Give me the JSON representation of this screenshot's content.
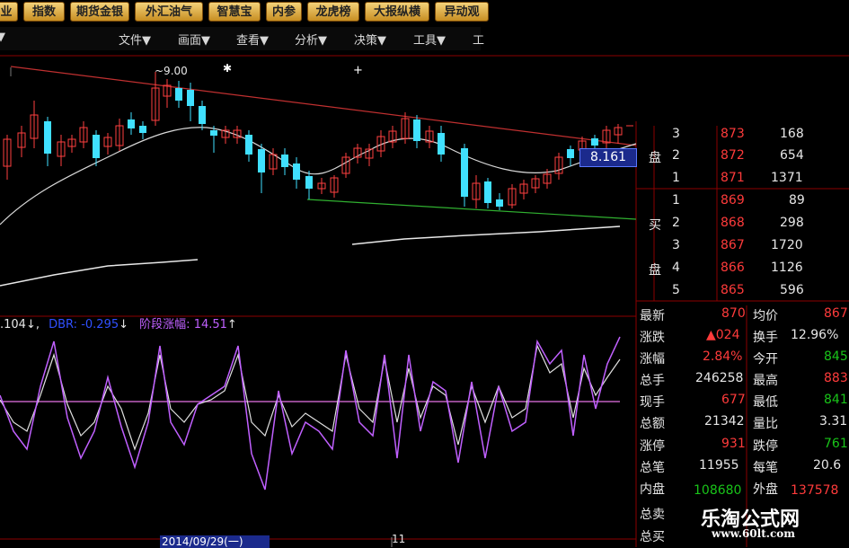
{
  "toolbar": [
    "业",
    "指数",
    "期货金银",
    "外汇油气",
    "智慧宝",
    "内参",
    "龙虎榜",
    "大报纵横",
    "异动观"
  ],
  "menu": [
    "文件▼",
    "画面▼",
    "查看▼",
    "分析▼",
    "决策▼",
    "工具▼",
    "工"
  ],
  "chart": {
    "high_label": "~9.00",
    "price_marker": "8.161",
    "date": "2014/09/29(一)",
    "marker_11": "11"
  },
  "indicator": {
    "v1": ".104",
    "v2": "0.295",
    "label": "阶段涨幅:",
    "value": "14.51"
  },
  "orderbook": {
    "sell_label": [
      "盘"
    ],
    "buy_label": [
      "买",
      "盘"
    ],
    "asks": [
      {
        "lvl": "3",
        "price": "873",
        "vol": "168"
      },
      {
        "lvl": "2",
        "price": "872",
        "vol": "654"
      },
      {
        "lvl": "1",
        "price": "871",
        "vol": "1371"
      }
    ],
    "bids": [
      {
        "lvl": "1",
        "price": "869",
        "vol": "89"
      },
      {
        "lvl": "2",
        "price": "868",
        "vol": "298"
      },
      {
        "lvl": "3",
        "price": "867",
        "vol": "1720"
      },
      {
        "lvl": "4",
        "price": "866",
        "vol": "1126"
      },
      {
        "lvl": "5",
        "price": "865",
        "vol": "596"
      }
    ]
  },
  "stats": [
    {
      "l1": "最新",
      "v1": "870",
      "l2": "均价",
      "v2": "867"
    },
    {
      "l1": "涨跌",
      "v1": "▲024",
      "l2": "换手",
      "v2": "12.96%"
    },
    {
      "l1": "涨幅",
      "v1": "2.84%",
      "l2": "今开",
      "v2": "845"
    },
    {
      "l1": "总手",
      "v1": "246258",
      "l2": "最高",
      "v2": "883"
    },
    {
      "l1": "现手",
      "v1": "677",
      "l2": "最低",
      "v2": "841"
    },
    {
      "l1": "总额",
      "v1": "21342",
      "l2": "量比",
      "v2": "3.31"
    },
    {
      "l1": "涨停",
      "v1": "931",
      "l2": "跌停",
      "v2": "761"
    },
    {
      "l1": "总笔",
      "v1": "11955",
      "l2": "每笔",
      "v2": "20.6"
    },
    {
      "l1": "内盘",
      "v1": "108680",
      "l2": "外盘",
      "v2": "137578"
    },
    {
      "l1": "总卖",
      "v1": "",
      "l2": "",
      "v2": ""
    },
    {
      "l1": "总买",
      "v1": "",
      "l2": "",
      "v2": ""
    }
  ],
  "watermark": {
    "cn": "乐淘公式网",
    "url": "www.60lt.com"
  }
}
